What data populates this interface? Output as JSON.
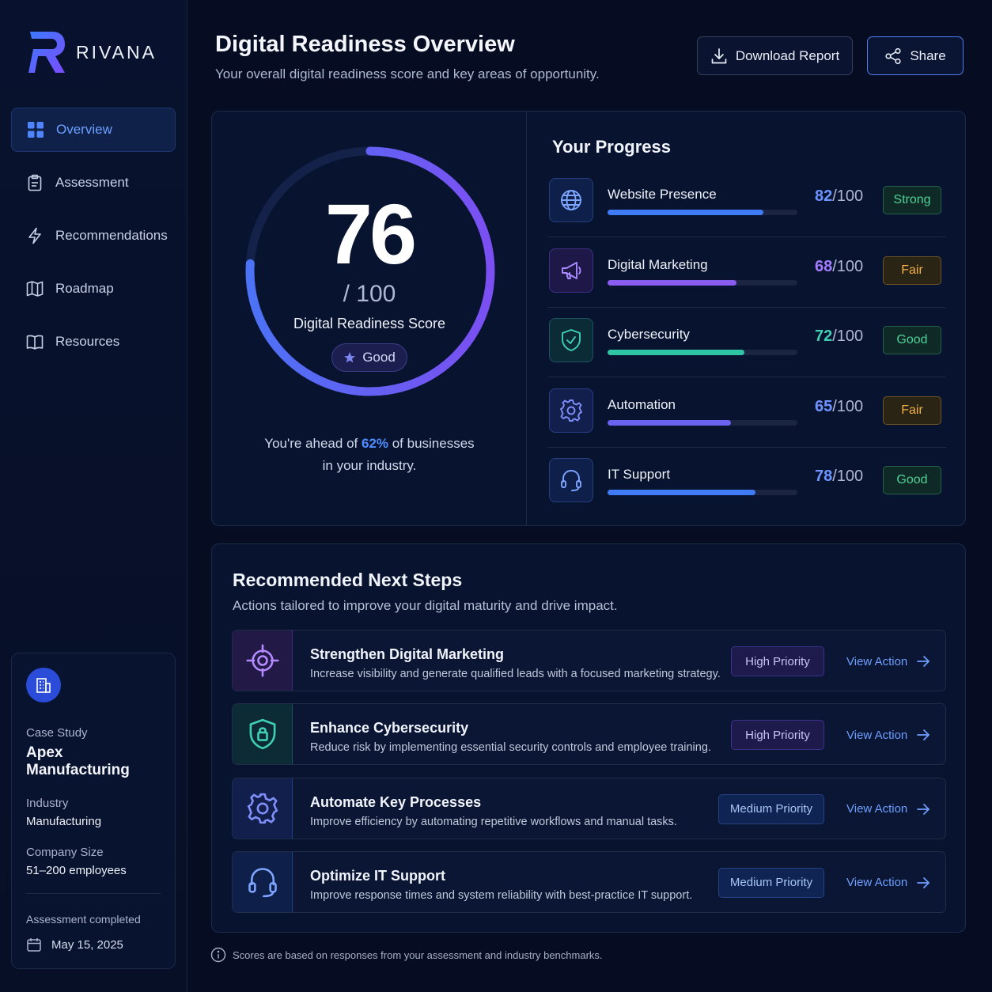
{
  "brand": {
    "name": "RIVANA"
  },
  "nav": [
    {
      "label": "Overview",
      "icon": "grid-icon",
      "active": true
    },
    {
      "label": "Assessment",
      "icon": "clipboard-icon",
      "active": false
    },
    {
      "label": "Recommendations",
      "icon": "bolt-icon",
      "active": false
    },
    {
      "label": "Roadmap",
      "icon": "map-icon",
      "active": false
    },
    {
      "label": "Resources",
      "icon": "book-icon",
      "active": false
    }
  ],
  "case_study": {
    "label": "Case Study",
    "name": "Apex Manufacturing",
    "industry_label": "Industry",
    "industry": "Manufacturing",
    "size_label": "Company Size",
    "size": "51–200 employees",
    "completed_label": "Assessment completed",
    "completed_date": "May 15, 2025"
  },
  "header": {
    "title": "Digital Readiness Overview",
    "subtitle": "Your overall digital readiness score and key areas of opportunity.",
    "download_label": "Download Report",
    "share_label": "Share"
  },
  "score": {
    "value": "76",
    "denominator": "/ 100",
    "label": "Digital Readiness Score",
    "badge": "Good",
    "fraction": 0.76,
    "ahead_prefix": "You're ahead of ",
    "ahead_pct": "62%",
    "ahead_suffix": " of businesses",
    "ahead_line2": "in your industry."
  },
  "progress": {
    "title": "Your Progress",
    "items": [
      {
        "name": "Website Presence",
        "value": 82,
        "max": "/100",
        "status": "Strong",
        "icon": "globe-icon",
        "color": "#3f7bf5",
        "status_color": "#4fd197"
      },
      {
        "name": "Digital Marketing",
        "value": 68,
        "max": "/100",
        "status": "Fair",
        "icon": "megaphone-icon",
        "color": "#8a5cf0",
        "status_color": "#f2b04a"
      },
      {
        "name": "Cybersecurity",
        "value": 72,
        "max": "/100",
        "status": "Good",
        "icon": "shield-check-icon",
        "color": "#2ec4a4",
        "status_color": "#4fd197"
      },
      {
        "name": "Automation",
        "value": 65,
        "max": "/100",
        "status": "Fair",
        "icon": "gear-icon",
        "color": "#6a62f0",
        "status_color": "#f2b04a"
      },
      {
        "name": "IT Support",
        "value": 78,
        "max": "/100",
        "status": "Good",
        "icon": "headset-icon",
        "color": "#3f7bf5",
        "status_color": "#4fd197"
      }
    ]
  },
  "recommendations": {
    "title": "Recommended Next Steps",
    "subtitle": "Actions tailored to improve your digital maturity and drive impact.",
    "action_label": "View Action",
    "items": [
      {
        "name": "Strengthen Digital Marketing",
        "desc": "Increase visibility and generate qualified leads with a focused marketing strategy.",
        "priority": "High Priority",
        "level": "high",
        "icon": "target-icon"
      },
      {
        "name": "Enhance Cybersecurity",
        "desc": "Reduce risk by implementing essential security controls and employee training.",
        "priority": "High Priority",
        "level": "high",
        "icon": "shield-lock-icon"
      },
      {
        "name": "Automate Key Processes",
        "desc": "Improve efficiency by automating repetitive workflows and manual tasks.",
        "priority": "Medium Priority",
        "level": "med",
        "icon": "gear-icon"
      },
      {
        "name": "Optimize IT Support",
        "desc": "Improve response times and system reliability with best-practice IT support.",
        "priority": "Medium Priority",
        "level": "med",
        "icon": "headset-icon"
      }
    ]
  },
  "footer": {
    "note": "Scores are based on responses from your assessment and industry benchmarks."
  }
}
